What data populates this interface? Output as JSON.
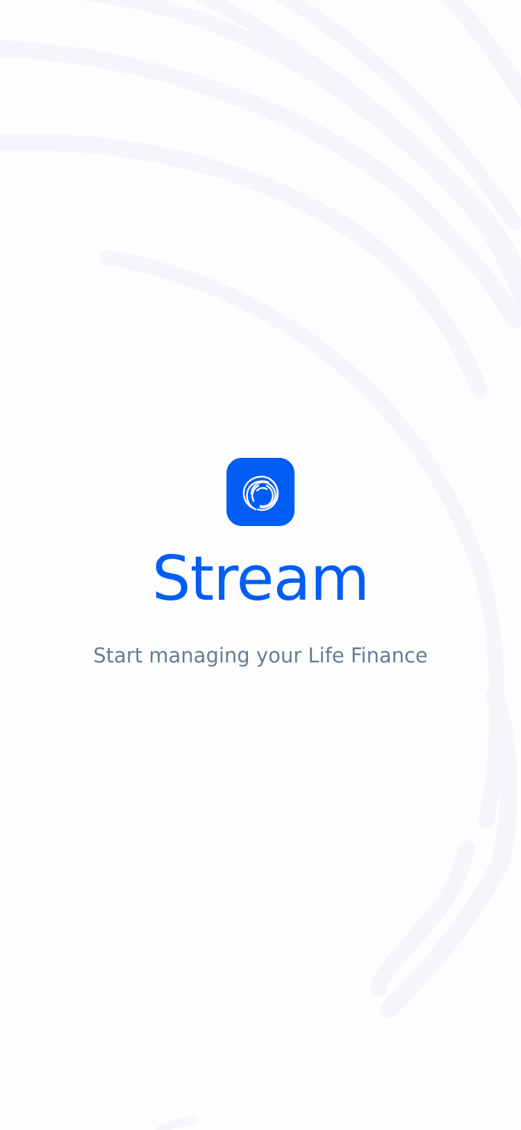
{
  "splash": {
    "app_icon": "stream-swirl-icon",
    "app_name": "Stream",
    "tagline": "Start managing your Life Finance"
  },
  "colors": {
    "brand": "#005ef5",
    "tagline": "#6b7a95",
    "background": "#fdfdfe",
    "swirl": "#f4f6fb"
  }
}
